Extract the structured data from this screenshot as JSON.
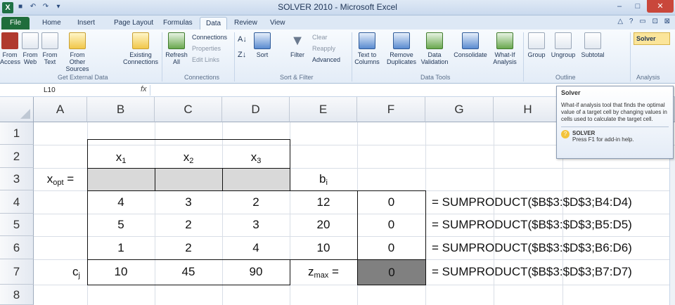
{
  "window": {
    "title": "SOLVER 2010 - Microsoft Excel",
    "app_icon": "X",
    "minimize": "–",
    "maximize": "□",
    "close": "✕"
  },
  "ribbon_tabs": [
    "File",
    "Home",
    "Insert",
    "Page Layout",
    "Formulas",
    "Data",
    "Review",
    "View"
  ],
  "ribbon": {
    "from_access": "From Access",
    "from_web": "From Web",
    "from_text": "From Text",
    "from_other": "From Other Sources",
    "existing": "Existing Connections",
    "group_get_external": "Get External Data",
    "refresh": "Refresh All",
    "connections": "Connections",
    "properties": "Properties",
    "edit_links": "Edit Links",
    "group_connections": "Connections",
    "sort": "Sort",
    "filter": "Filter",
    "clear": "Clear",
    "reapply": "Reapply",
    "advanced": "Advanced",
    "group_sort_filter": "Sort & Filter",
    "text_to_columns": "Text to Columns",
    "remove_duplicates": "Remove Duplicates",
    "data_validation": "Data Validation",
    "consolidate": "Consolidate",
    "what_if": "What-If Analysis",
    "group_data_tools": "Data Tools",
    "group": "Group",
    "ungroup": "Ungroup",
    "subtotal": "Subtotal",
    "group_outline": "Outline",
    "solver": "Solver",
    "group_analysis": "Analysis"
  },
  "formula_bar": {
    "name_box": "L10",
    "fx": "fx"
  },
  "columns": [
    "A",
    "B",
    "C",
    "D",
    "E",
    "F",
    "G",
    "H"
  ],
  "rows": [
    "1",
    "2",
    "3",
    "4",
    "5",
    "6",
    "7",
    "8"
  ],
  "sheet": {
    "headers": [
      {
        "base": "x",
        "sub": "1"
      },
      {
        "base": "x",
        "sub": "2"
      },
      {
        "base": "x",
        "sub": "3"
      }
    ],
    "xopt_label": {
      "base": "x",
      "sub": "opt",
      "suffix": " ="
    },
    "bi_label": {
      "base": "b",
      "sub": "i"
    },
    "matrix": [
      [
        "4",
        "3",
        "2",
        "12",
        "0"
      ],
      [
        "5",
        "2",
        "3",
        "20",
        "0"
      ],
      [
        "1",
        "2",
        "4",
        "10",
        "0"
      ]
    ],
    "cj_label": {
      "base": "c",
      "sub": "j"
    },
    "cj_values": [
      "10",
      "45",
      "90"
    ],
    "zmax_label": {
      "base": "z",
      "sub": "max",
      "suffix": " ="
    },
    "zmax_value": "0",
    "formulas": [
      "= SUMPRODUCT($B$3:$D$3;B4:D4)",
      "= SUMPRODUCT($B$3:$D$3;B5:D5)",
      "= SUMPRODUCT($B$3:$D$3;B6:D6)",
      "= SUMPRODUCT($B$3:$D$3;B7:D7)"
    ]
  },
  "tooltip": {
    "title": "Solver",
    "body": "What-if analysis tool that finds the optimal value of a target cell by changing values in cells used to calculate the target cell.",
    "addin_name": "SOLVER",
    "addin_help": "Press F1 for add-in help."
  }
}
